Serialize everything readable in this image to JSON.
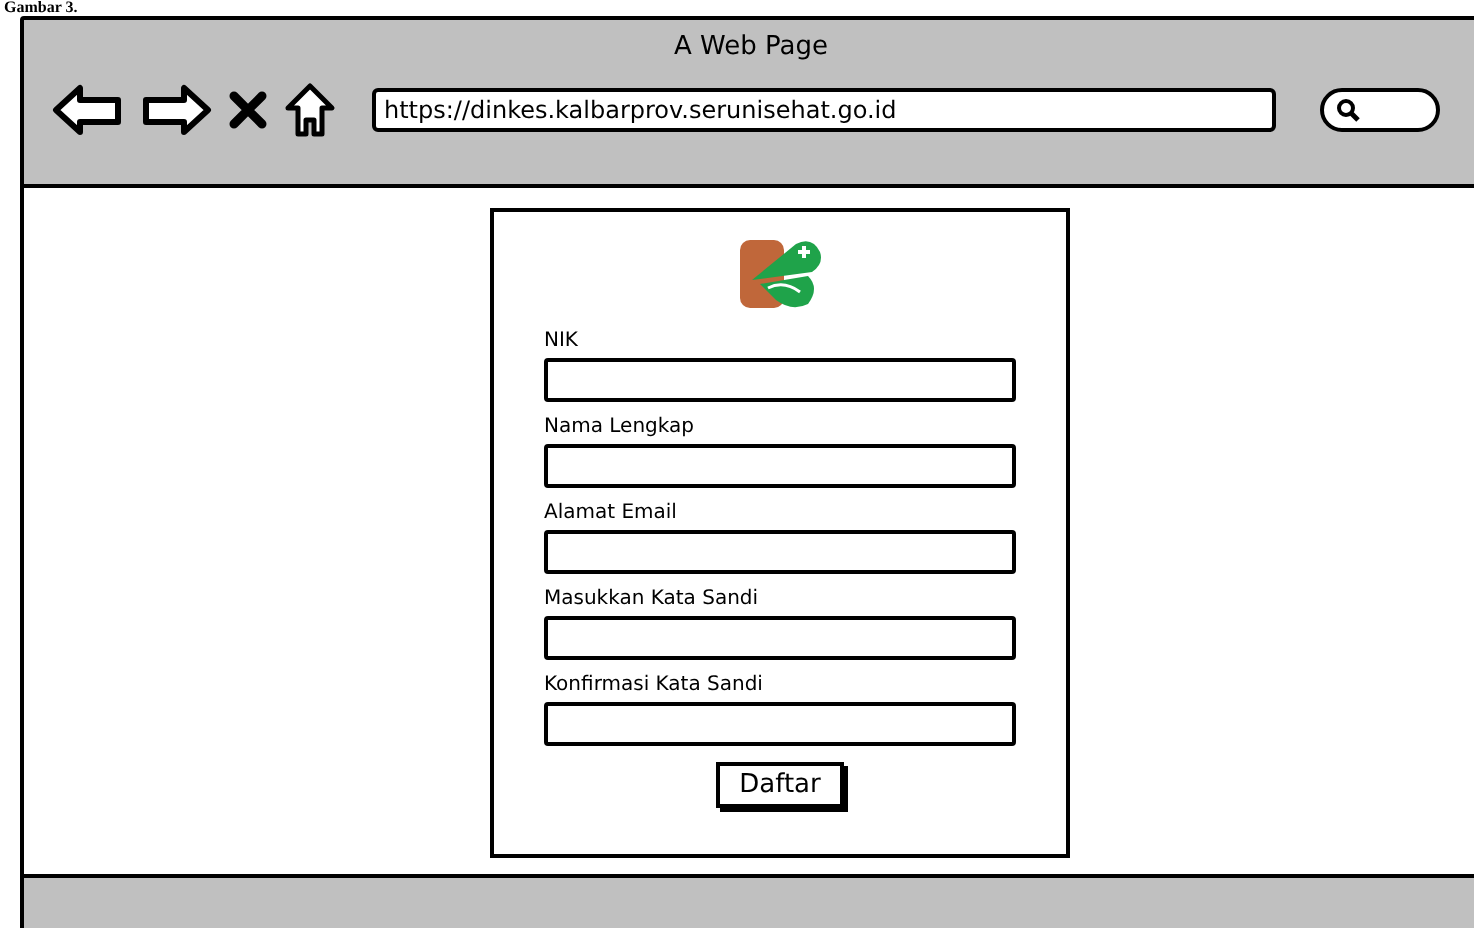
{
  "caption": "Gambar 3.",
  "window": {
    "title": "A Web Page"
  },
  "toolbar": {
    "url": "https://dinkes.kalbarprov.serunisehat.go.id"
  },
  "form": {
    "fields": [
      {
        "label": "NIK"
      },
      {
        "label": "Nama Lengkap"
      },
      {
        "label": "Alamat Email"
      },
      {
        "label": "Masukkan Kata Sandi"
      },
      {
        "label": "Konfirmasi Kata Sandi"
      }
    ],
    "submit": "Daftar"
  }
}
